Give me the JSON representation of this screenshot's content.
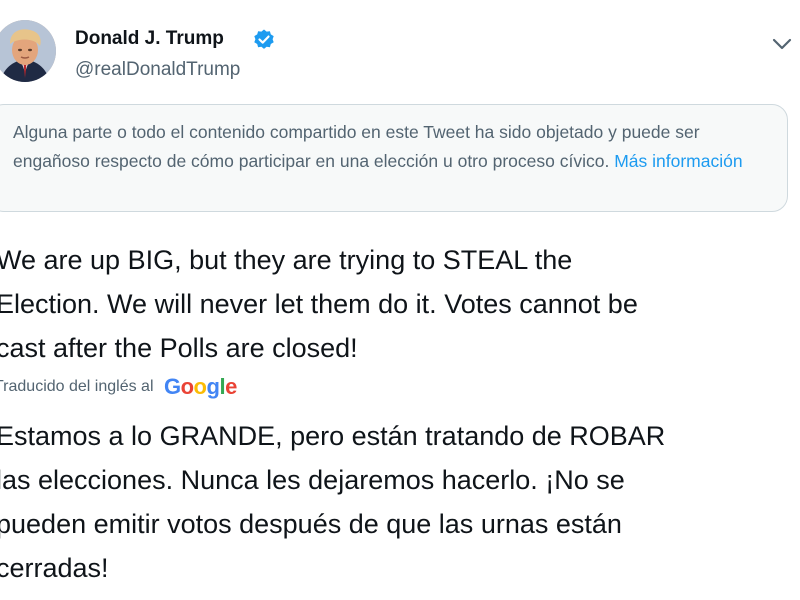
{
  "author": {
    "name": "Donald J. Trump",
    "handle": "@realDonaldTrump",
    "verified_color": "#1d9bf0"
  },
  "notice": {
    "text": "Alguna parte o todo el contenido compartido en este Tweet ha sido objetado y puede ser engañoso respecto de cómo participar en una elección u otro proceso cívico. ",
    "link": "Más información"
  },
  "tweet": {
    "lines": [
      "We are up BIG, but they are trying to STEAL the",
      "Election. We will never let them do it. Votes cannot be",
      "cast after the Polls are closed!"
    ]
  },
  "translation": {
    "label": "Traducido del inglés al",
    "provider": "Google",
    "lines": [
      "Estamos a lo GRANDE, pero están tratando de ROBAR",
      "las elecciones. Nunca les dejaremos hacerlo. ¡No se",
      "pueden emitir votos después de que las urnas están",
      "cerradas!"
    ]
  }
}
